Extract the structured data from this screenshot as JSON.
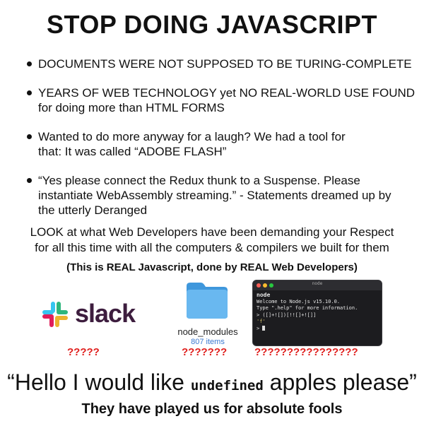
{
  "title": "STOP DOING JAVASCRIPT",
  "bullets": [
    {
      "line1": "DOCUMENTS WERE NOT SUPPOSED TO BE TURING-COMPLETE"
    },
    {
      "line1": "YEARS OF WEB TECHNOLOGY yet NO REAL-WORLD USE FOUND",
      "line2": "for doing more than HTML FORMS"
    },
    {
      "line1": "Wanted to do more anyway for a laugh? We had a tool for",
      "line2": "that: It was called “ADOBE FLASH”"
    },
    {
      "line1": "“Yes please connect the Redux thunk to a Suspense. Please",
      "line2": "instantiate WebAssembly streaming.” - Statements dreamed up by",
      "line3": "the utterly Deranged"
    }
  ],
  "look": {
    "line1": "LOOK at what Web Developers have been demanding your Respect",
    "line2": "for all this time with all the computers & compilers we built for them"
  },
  "real_note": "(This is REAL Javascript, done by REAL Web Developers)",
  "slack": {
    "word": "slack",
    "question": "?????"
  },
  "folder": {
    "caption": "node_modules",
    "sub": "807 items",
    "question": "???????"
  },
  "terminal": {
    "title": "node",
    "tab": "node",
    "lines": [
      "Welcome to Node.js v15.10.0.",
      "Type \".help\" for more information.",
      "> ([]+![])[!![]+![]]"
    ],
    "result": "'f'",
    "prompt": ">",
    "question": "????????????????"
  },
  "quote": {
    "before": "“Hello I would like ",
    "mono": "undefined",
    "after": " apples please”"
  },
  "footer": "They have played us for absolute fools",
  "colors": {
    "slack_text": "#3d1d3e",
    "question": "#e0201e",
    "folder": "#5aaee8",
    "terminal_bg": "#1c1c1f"
  }
}
